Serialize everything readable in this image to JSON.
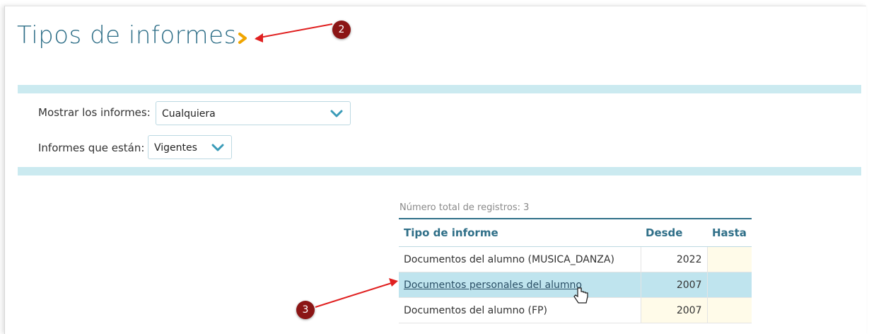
{
  "page": {
    "title": "Tipos de informes"
  },
  "filters": {
    "show_label": "Mostrar los informes:",
    "show_value": "Cualquiera",
    "state_label": "Informes que están:",
    "state_value": "Vigentes"
  },
  "table": {
    "total_text": "Número total de registros: 3",
    "headers": [
      "Tipo de informe",
      "Desde",
      "Hasta"
    ],
    "rows": [
      {
        "tipo": "Documentos del alumno (MUSICA_DANZA)",
        "desde": "2022",
        "hasta": ""
      },
      {
        "tipo": "Documentos personales del alumno",
        "desde": "2007",
        "hasta": ""
      },
      {
        "tipo": "Documentos del alumno (FP)",
        "desde": "2007",
        "hasta": ""
      }
    ],
    "selected_row": 1
  },
  "annotations": {
    "marker_a": "2",
    "marker_b": "3"
  },
  "colors": {
    "accent": "#2f6f88",
    "band": "#cbeaf0",
    "chevron": "#f0a500",
    "marker": "#8b1515",
    "arrow": "#e02020",
    "selected_row": "#bfe4ee"
  },
  "icons": {
    "title_chevron": "chevron-right-icon",
    "dropdown": "chevron-down-icon",
    "cursor": "hand-pointer-icon"
  }
}
